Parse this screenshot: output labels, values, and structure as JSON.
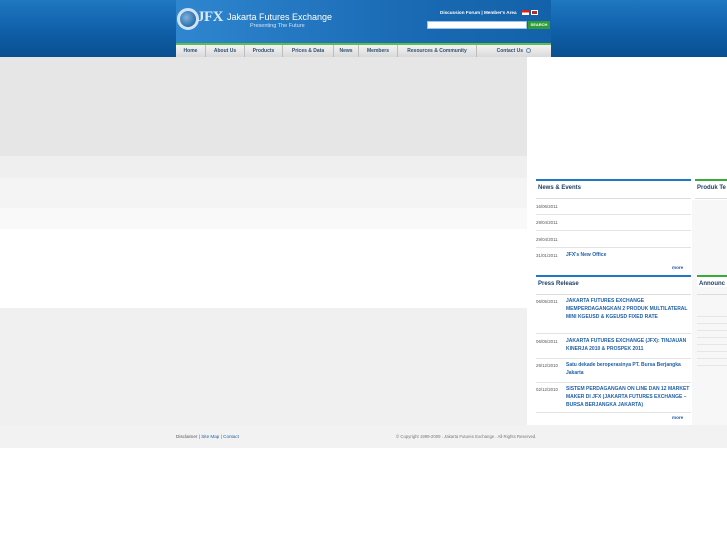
{
  "header": {
    "logo_mark": "JFX",
    "title": "Jakarta Futures Exchange",
    "tagline": "Presenting The Future",
    "top_links": [
      "Discussion Forum",
      "Member's Area"
    ],
    "top_links_separator": "|",
    "search": {
      "placeholder": "",
      "button_label": "SEARCH"
    }
  },
  "nav": {
    "items": [
      "Home",
      "About Us",
      "Products",
      "Prices & Data",
      "News",
      "Members",
      "Resources & Community",
      "Contact Us"
    ]
  },
  "news_events": {
    "heading": "News & Events",
    "items": [
      {
        "date": "16/06/2011",
        "title": ""
      },
      {
        "date": "29/04/2011",
        "title": ""
      },
      {
        "date": "29/04/2011",
        "title": ""
      },
      {
        "date": "31/01/2011",
        "title": "JFX's New Office"
      }
    ],
    "more_label": "more"
  },
  "side_headings": {
    "produk": "Produk Te",
    "announce": "Announc"
  },
  "press_release": {
    "heading": "Press Release",
    "items": [
      {
        "date": "06/05/2011",
        "title": "JAKARTA FUTURES EXCHANGE MEMPERDAGANGKAN 2 PRODUK MULTILATERAL MINI KGEUSD & KGEUSD FIXED RATE"
      },
      {
        "date": "06/05/2011",
        "title": "JAKARTA FUTURES EXCHANGE (JFX): TINJAUAN KINERJA 2010 & PROSPEK 2011"
      },
      {
        "date": "29/12/2010",
        "title": "Satu dekade beroperasinya PT. Bursa Berjangka Jakarta"
      },
      {
        "date": "02/12/2010",
        "title": "SISTEM PERDAGANGAN ON LINE DAN 12 MARKET MAKER DI JFX (JAKARTA FUTURES EXCHANGE – BURSA BERJANGKA JAKARTA)"
      }
    ],
    "more_label": "more"
  },
  "footer": {
    "links": [
      "Disclaimer",
      "Site Map",
      "Contact"
    ],
    "separator": "|",
    "copyright": "© Copyright 1999-2009 . Jakarta Futures Exchange . All Rights Reserved."
  }
}
